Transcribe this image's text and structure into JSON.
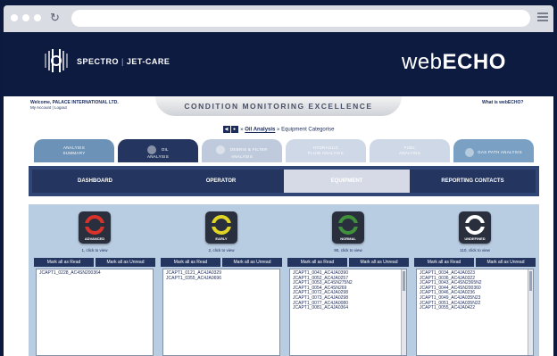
{
  "browser": {
    "reload_icon": "reload-icon",
    "menu_icon": "hamburger-menu-icon"
  },
  "header": {
    "brand_left": "SPECTRO",
    "brand_right": "JET-CARE",
    "product_light": "web",
    "product_bold": "ECHO",
    "logo_icon": "spectro-logo-icon",
    "colors": {
      "background": "#0e1b40"
    }
  },
  "topbar": {
    "welcome": "Welcome, PALACE INTERNATIONAL LTD.",
    "account_link": "My Account",
    "logout_link": "Logout",
    "banner": "CONDITION MONITORING EXCELLENCE",
    "what_link": "What is webECHO?"
  },
  "breadcrumb": {
    "link": "Oil Analysis",
    "current": "Equipment Categorise",
    "separator": "»"
  },
  "tabs": [
    {
      "line1": "ANALYSIS",
      "line2": "SUMMARY",
      "color": "#6c92b8"
    },
    {
      "line1": "OIL",
      "line2": "ANALYSIS",
      "color": "#24365f"
    },
    {
      "line1": "DEBRIS & FILTER",
      "line2": "ANALYSIS",
      "color": "#bfcbdc"
    },
    {
      "line1": "HYDRAULIC",
      "line2": "FLUID ANALYSIS",
      "color": "#cfd8e6"
    },
    {
      "line1": "FUEL",
      "line2": "ANALYSIS",
      "color": "#cfd8e6"
    },
    {
      "line1": "GAS PATH ANALYSIS",
      "line2": "",
      "color": "#7aa0c4"
    }
  ],
  "nav": {
    "dashboard": "DASHBOARD",
    "operator": "OPERATOR",
    "equipment": "EQUIPMENT",
    "reporting": "REPORTING CONTACTS"
  },
  "categories": [
    {
      "label": "ADVANCED",
      "color": "#d8322a",
      "count_text": "1, click to view",
      "mark_read": "Mark all as Read",
      "mark_unread": "Mark all as Unread",
      "items": [
        "JCAPT1_0228_AC4SN200364"
      ]
    },
    {
      "label": "EARLY",
      "color": "#e0d526",
      "count_text": "2, click to view",
      "mark_read": "Mark all as Read",
      "mark_unread": "Mark all as Unread",
      "items": [
        "JCAPT1_0121_AC4JA0329",
        "JCAPT1_0355_AC4JA0696"
      ]
    },
    {
      "label": "NORMAL",
      "color": "#3f8f3b",
      "count_text": "90, click to view",
      "mark_read": "Mark all as Read",
      "mark_unread": "Mark all as Unread",
      "items": [
        "JCAPT1_0041_AC4JA0390",
        "JCAPT1_0052_AC4JA0257",
        "JCAPT1_0053_AC4SN275N2",
        "JCAPT1_0054_AC4SN269",
        "JCAPT1_0072_AC4JA0298",
        "JCAPT1_0073_AC4JA0298",
        "JCAPT1_0077_AC4JA0080",
        "JCAPT1_0081_AC4JA0364"
      ]
    },
    {
      "label": "UNDEFINED",
      "color": "#ffffff",
      "count_text": "110, click to view",
      "mark_read": "Mark all as Read",
      "mark_unread": "Mark all as Unread",
      "items": [
        "JCAPT1_0034_AC4JA0323",
        "JCAPT1_0036_AC4JA0322",
        "JCAPT1_0043_AC4SN2365N2",
        "JCAPT1_0044_AC4SN200360",
        "JCAPT1_0046_AC4JA0236",
        "JCAPT1_0049_AC4JA035N23",
        "JCAPT1_0051_AC4JA035N22",
        "JCAPT1_0055_AC4JA0422"
      ]
    }
  ]
}
